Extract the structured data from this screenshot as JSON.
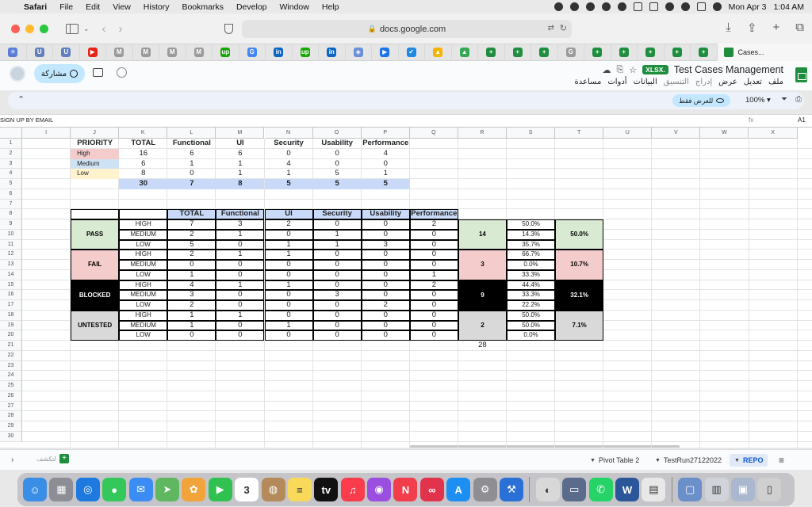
{
  "menubar": {
    "app": "Safari",
    "menus": [
      "File",
      "Edit",
      "View",
      "History",
      "Bookmarks",
      "Develop",
      "Window",
      "Help"
    ],
    "date": "Mon Apr 3",
    "time": "1:04 AM"
  },
  "browser": {
    "url": "docs.google.com",
    "active_tab_label": "Cases...",
    "pinned_tabs": [
      {
        "icon": "sparkle-icon",
        "color": "#5a7ed6",
        "glyph": "✳"
      },
      {
        "icon": "upwork-u-icon",
        "color": "#5f7fbd",
        "glyph": "U"
      },
      {
        "icon": "upwork-u-icon",
        "color": "#5f7fbd",
        "glyph": "U"
      },
      {
        "icon": "youtube-icon",
        "color": "#e62117",
        "glyph": "▶"
      },
      {
        "icon": "gmail-m-icon",
        "color": "#9a9a9a",
        "glyph": "M"
      },
      {
        "icon": "gmail-m-icon",
        "color": "#9a9a9a",
        "glyph": "M"
      },
      {
        "icon": "gmail-m-icon",
        "color": "#9a9a9a",
        "glyph": "M"
      },
      {
        "icon": "gmail-m-icon",
        "color": "#9a9a9a",
        "glyph": "M"
      },
      {
        "icon": "upwork-icon",
        "color": "#14a800",
        "glyph": "up"
      },
      {
        "icon": "google-icon",
        "color": "#4285f4",
        "glyph": "G"
      },
      {
        "icon": "linkedin-icon",
        "color": "#0a66c2",
        "glyph": "in"
      },
      {
        "icon": "upwork-icon",
        "color": "#14a800",
        "glyph": "up"
      },
      {
        "icon": "linkedin-icon",
        "color": "#0a66c2",
        "glyph": "in"
      },
      {
        "icon": "shield-badge-icon",
        "color": "#6a8fd8",
        "glyph": "◈"
      },
      {
        "icon": "play-store-icon",
        "color": "#1a73e8",
        "glyph": "▶"
      },
      {
        "icon": "check-badge-icon",
        "color": "#1e88e5",
        "glyph": "✔"
      },
      {
        "icon": "drive-icon",
        "color": "#f4b400",
        "glyph": "▲"
      },
      {
        "icon": "drive-icon",
        "color": "#34a853",
        "glyph": "▲"
      },
      {
        "icon": "sheets-plus-icon",
        "color": "#1e8e3e",
        "glyph": "+"
      },
      {
        "icon": "sheets-plus-icon",
        "color": "#1e8e3e",
        "glyph": "+"
      },
      {
        "icon": "sheets-plus-icon",
        "color": "#1e8e3e",
        "glyph": "+"
      },
      {
        "icon": "g-gray-icon",
        "color": "#9a9a9a",
        "glyph": "G"
      },
      {
        "icon": "sheets-plus-icon",
        "color": "#1e8e3e",
        "glyph": "+"
      },
      {
        "icon": "sheets-plus-icon",
        "color": "#1e8e3e",
        "glyph": "+"
      },
      {
        "icon": "sheets-plus-icon",
        "color": "#1e8e3e",
        "glyph": "+"
      },
      {
        "icon": "sheets-plus-icon",
        "color": "#1e8e3e",
        "glyph": "+"
      },
      {
        "icon": "sheets-plus-icon",
        "color": "#1e8e3e",
        "glyph": "+"
      }
    ]
  },
  "docs": {
    "title": "Test Cases Management",
    "file_badge": "XLSX.",
    "share_label": "مشاركة",
    "menus": [
      "ملف",
      "تعديل",
      "عرض",
      "إدراج",
      "التنسيق",
      "البيانات",
      "أدوات",
      "مساعدة"
    ],
    "menus_disabled": [
      false,
      false,
      false,
      true,
      true,
      false,
      false,
      false
    ],
    "view_only_label": "للعرض فقط",
    "zoom": "100%",
    "formula_content": "SIGN UP BY EMAIL",
    "fx_label": "fx",
    "cell_ref": "A1"
  },
  "grid": {
    "columns": [
      "I",
      "J",
      "K",
      "L",
      "M",
      "N",
      "O",
      "P",
      "Q",
      "R",
      "S",
      "T",
      "U",
      "V",
      "W",
      "X"
    ],
    "row_numbers": [
      "1",
      "2",
      "3",
      "4",
      "5",
      "6",
      "7",
      "8",
      "9",
      "10",
      "11",
      "12",
      "13",
      "14",
      "15",
      "16",
      "17",
      "18",
      "19",
      "20",
      "21",
      "22",
      "23",
      "24",
      "25",
      "26",
      "27",
      "28",
      "29",
      "30"
    ]
  },
  "priority_table": {
    "headers": [
      "PRIORITY",
      "TOTAL",
      "Functional",
      "UI",
      "Security",
      "Usability",
      "Performance"
    ],
    "rows": [
      {
        "label": "High",
        "color": "#f4cccc",
        "values": [
          "16",
          "6",
          "6",
          "0",
          "0",
          "4"
        ]
      },
      {
        "label": "Medium",
        "color": "#cfe2f3",
        "values": [
          "6",
          "1",
          "1",
          "4",
          "0",
          "0"
        ]
      },
      {
        "label": "Low",
        "color": "#fff2cc",
        "values": [
          "8",
          "0",
          "1",
          "1",
          "5",
          "1"
        ]
      }
    ],
    "totals": [
      "30",
      "7",
      "8",
      "5",
      "5",
      "5"
    ],
    "totals_color": "#c9daf8"
  },
  "status_table": {
    "headers": [
      "TOTAL",
      "Functional",
      "UI",
      "Security",
      "Usability",
      "Performance"
    ],
    "header_color": "#c9daf8",
    "groups": [
      {
        "status": "PASS",
        "bg": "#d9ead3",
        "fg": "#000000",
        "count": "14",
        "percent": "50.0%",
        "rows": [
          {
            "level": "HIGH",
            "values": [
              "7",
              "3",
              "2",
              "0",
              "0",
              "2"
            ],
            "pct": "50.0%"
          },
          {
            "level": "MEDIUM",
            "values": [
              "2",
              "1",
              "0",
              "1",
              "0",
              "0"
            ],
            "pct": "14.3%"
          },
          {
            "level": "LOW",
            "values": [
              "5",
              "0",
              "1",
              "1",
              "3",
              "0"
            ],
            "pct": "35.7%"
          }
        ]
      },
      {
        "status": "FAIL",
        "bg": "#f4cccc",
        "fg": "#000000",
        "count": "3",
        "percent": "10.7%",
        "rows": [
          {
            "level": "HIGH",
            "values": [
              "2",
              "1",
              "1",
              "0",
              "0",
              "0"
            ],
            "pct": "66.7%"
          },
          {
            "level": "MEDIUM",
            "values": [
              "0",
              "0",
              "0",
              "0",
              "0",
              "0"
            ],
            "pct": "0.0%"
          },
          {
            "level": "LOW",
            "values": [
              "1",
              "0",
              "0",
              "0",
              "0",
              "1"
            ],
            "pct": "33.3%"
          }
        ]
      },
      {
        "status": "BLOCKED",
        "bg": "#000000",
        "fg": "#ffffff",
        "count": "9",
        "percent": "32.1%",
        "rows": [
          {
            "level": "HIGH",
            "values": [
              "4",
              "1",
              "1",
              "0",
              "0",
              "2"
            ],
            "pct": "44.4%"
          },
          {
            "level": "MEDIUM",
            "values": [
              "3",
              "0",
              "0",
              "3",
              "0",
              "0"
            ],
            "pct": "33.3%"
          },
          {
            "level": "LOW",
            "values": [
              "2",
              "0",
              "0",
              "0",
              "2",
              "0"
            ],
            "pct": "22.2%"
          }
        ]
      },
      {
        "status": "UNTESTED",
        "bg": "#d9d9d9",
        "fg": "#000000",
        "count": "2",
        "percent": "7.1%",
        "rows": [
          {
            "level": "HIGH",
            "values": [
              "1",
              "1",
              "0",
              "0",
              "0",
              "0"
            ],
            "pct": "50.0%"
          },
          {
            "level": "MEDIUM",
            "values": [
              "1",
              "0",
              "1",
              "0",
              "0",
              "0"
            ],
            "pct": "50.0%"
          },
          {
            "level": "LOW",
            "values": [
              "0",
              "0",
              "0",
              "0",
              "0",
              "0"
            ],
            "pct": "0.0%"
          }
        ]
      }
    ],
    "grand_total": "28"
  },
  "sheet_tabs": {
    "listed_label": "لتكشف",
    "tabs": [
      {
        "label": "Pivot Table 2",
        "active": false
      },
      {
        "label": "TestRun27122022",
        "active": false
      },
      {
        "label": "REPO",
        "active": true
      }
    ]
  },
  "dock": {
    "apps": [
      {
        "name": "finder-icon",
        "color": "#3a8ee6",
        "glyph": "☺"
      },
      {
        "name": "launchpad-icon",
        "color": "#8d8d95",
        "glyph": "▦"
      },
      {
        "name": "safari-icon",
        "color": "#1f7ae0",
        "glyph": "◎"
      },
      {
        "name": "messages-icon",
        "color": "#34c759",
        "glyph": "●"
      },
      {
        "name": "mail-icon",
        "color": "#3b8cf5",
        "glyph": "✉"
      },
      {
        "name": "maps-icon",
        "color": "#5fb760",
        "glyph": "➤"
      },
      {
        "name": "photos-icon",
        "color": "#f2a33a",
        "glyph": "✿"
      },
      {
        "name": "facetime-icon",
        "color": "#31c150",
        "glyph": "▶"
      },
      {
        "name": "calendar-icon",
        "color": "#ffffff",
        "glyph": "3"
      },
      {
        "name": "contacts-icon",
        "color": "#b58a5a",
        "glyph": "◍"
      },
      {
        "name": "notes-icon",
        "color": "#f8d95a",
        "glyph": "≡"
      },
      {
        "name": "apple-tv-icon",
        "color": "#111111",
        "glyph": "tv"
      },
      {
        "name": "music-icon",
        "color": "#fa3c4c",
        "glyph": "♫"
      },
      {
        "name": "podcasts-icon",
        "color": "#9b4fe0",
        "glyph": "◉"
      },
      {
        "name": "news-icon",
        "color": "#f23d4c",
        "glyph": "N"
      },
      {
        "name": "creative-cloud-icon",
        "color": "#e1344c",
        "glyph": "∞"
      },
      {
        "name": "app-store-icon",
        "color": "#1d8ff2",
        "glyph": "A"
      },
      {
        "name": "system-settings-icon",
        "color": "#8e8e93",
        "glyph": "⚙"
      },
      {
        "name": "xcode-icon",
        "color": "#2a70d6",
        "glyph": "⚒"
      },
      {
        "name": "preview-icon",
        "color": "#d8d8d8",
        "glyph": "◐"
      },
      {
        "name": "screen-share-icon",
        "color": "#5a6b8c",
        "glyph": "▭"
      },
      {
        "name": "whatsapp-icon",
        "color": "#25d366",
        "glyph": "✆"
      },
      {
        "name": "word-icon",
        "color": "#2b579a",
        "glyph": "W"
      },
      {
        "name": "document-icon",
        "color": "#e8e8e8",
        "glyph": "▤"
      },
      {
        "name": "browser-window-icon",
        "color": "#6a8fc9",
        "glyph": "▢"
      },
      {
        "name": "finder-window-icon",
        "color": "#d0d4da",
        "glyph": "▥"
      },
      {
        "name": "desktop-window-icon",
        "color": "#a9b8cf",
        "glyph": "▣"
      },
      {
        "name": "trash-icon",
        "color": "#cfcfcf",
        "glyph": "▯"
      }
    ]
  }
}
